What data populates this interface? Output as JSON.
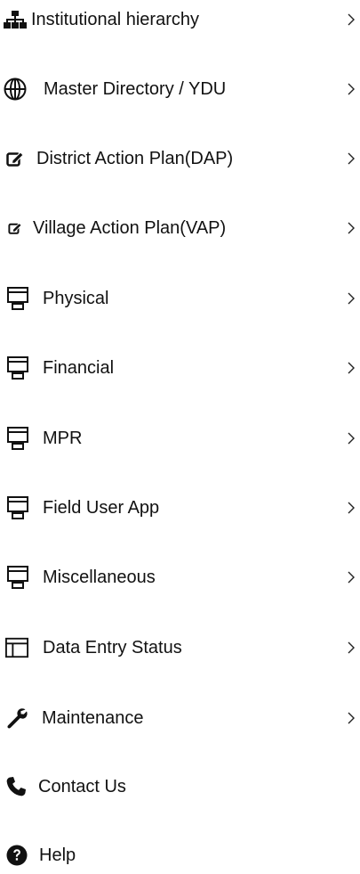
{
  "menu": {
    "items": [
      {
        "label": "Institutional hierarchy",
        "icon": "sitemap-icon",
        "has_chevron": true
      },
      {
        "label": "Master Directory / YDU",
        "icon": "globe-icon",
        "has_chevron": true
      },
      {
        "label": "District Action Plan(DAP)",
        "icon": "edit-icon",
        "has_chevron": true
      },
      {
        "label": "Village Action Plan(VAP)",
        "icon": "edit-icon",
        "has_chevron": true
      },
      {
        "label": "Physical",
        "icon": "window-icon",
        "has_chevron": true
      },
      {
        "label": "Financial",
        "icon": "window-icon",
        "has_chevron": true
      },
      {
        "label": "MPR",
        "icon": "window-icon",
        "has_chevron": true
      },
      {
        "label": "Field User App",
        "icon": "window-icon",
        "has_chevron": true
      },
      {
        "label": "Miscellaneous",
        "icon": "window-icon",
        "has_chevron": true
      },
      {
        "label": "Data Entry Status",
        "icon": "table-layout-icon",
        "has_chevron": true
      },
      {
        "label": "Maintenance",
        "icon": "wrench-icon",
        "has_chevron": true
      },
      {
        "label": "Contact Us",
        "icon": "phone-icon",
        "has_chevron": false
      },
      {
        "label": "Help",
        "icon": "question-circle-icon",
        "has_chevron": false
      }
    ]
  },
  "colors": {
    "text": "#111111",
    "background": "#ffffff",
    "chevron": "#222222"
  }
}
